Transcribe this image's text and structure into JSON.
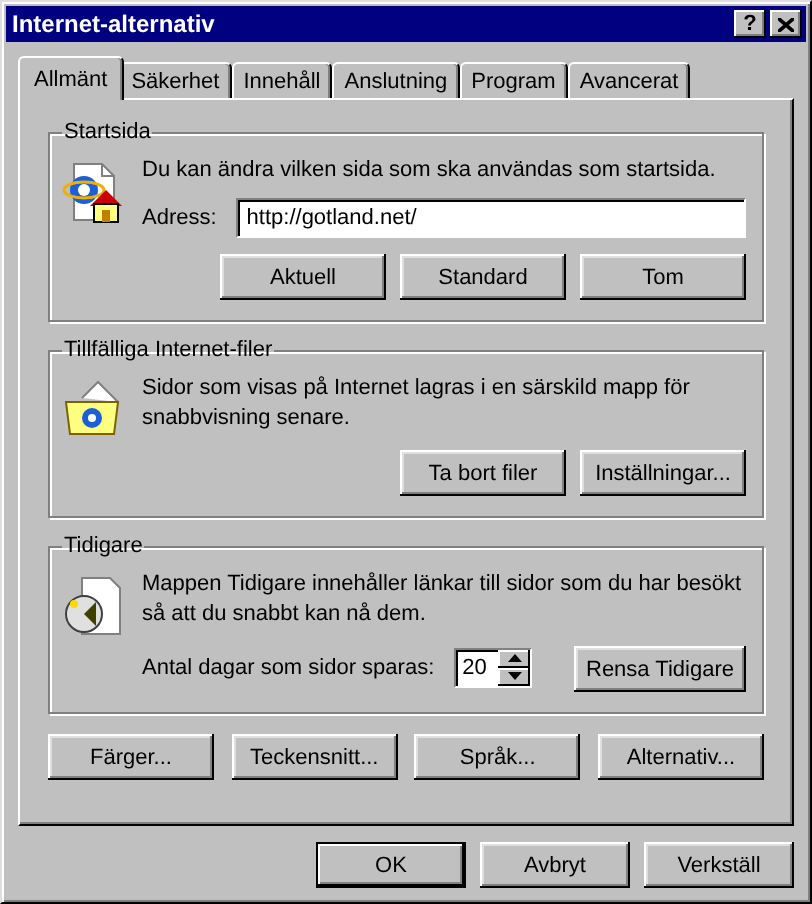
{
  "window": {
    "title": "Internet-alternativ",
    "help_button": "?"
  },
  "tabs": [
    {
      "label": "Allmänt",
      "selected": true
    },
    {
      "label": "Säkerhet",
      "selected": false
    },
    {
      "label": "Innehåll",
      "selected": false
    },
    {
      "label": "Anslutning",
      "selected": false
    },
    {
      "label": "Program",
      "selected": false
    },
    {
      "label": "Avancerat",
      "selected": false
    }
  ],
  "groups": [
    {
      "kind": "home",
      "title": "Startsida",
      "description": "Du kan ändra vilken sida som ska användas som startsida.",
      "field_label": "Adress:",
      "field_value": "http://gotland.net/",
      "buttons": [
        "Aktuell",
        "Standard",
        "Tom"
      ]
    },
    {
      "kind": "cache",
      "title": "Tillfälliga Internet-filer",
      "description": "Sidor som visas på Internet lagras i en särskild mapp för snabbvisning senare.",
      "buttons": [
        "Ta bort filer",
        "Inställningar..."
      ]
    },
    {
      "kind": "history",
      "title": "Tidigare",
      "description": "Mappen Tidigare innehåller länkar till sidor som du har besökt så att du snabbt kan nå dem.",
      "field_label": "Antal dagar som sidor sparas:",
      "field_value": "20",
      "buttons": [
        "Rensa Tidigare"
      ]
    }
  ],
  "bottom_buttons": [
    "Färger...",
    "Teckensnitt...",
    "Språk...",
    "Alternativ..."
  ],
  "dialog_buttons": [
    {
      "label": "OK",
      "default": true
    },
    {
      "label": "Avbryt",
      "default": false
    },
    {
      "label": "Verkställ",
      "default": false
    }
  ]
}
